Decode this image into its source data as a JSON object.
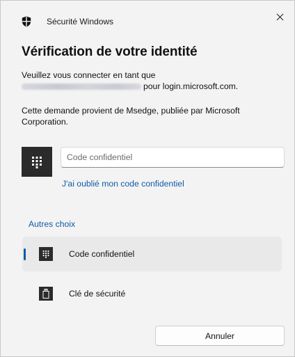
{
  "app": {
    "title": "Sécurité Windows",
    "icon": "windows-security-shield-icon"
  },
  "dialog": {
    "heading": "Vérification de votre identité",
    "connect_prefix": "Veuillez vous connecter en tant que",
    "connect_suffix": "pour login.microsoft.com.",
    "request_text": "Cette demande provient de Msedge, publiée par Microsoft Corporation."
  },
  "pin": {
    "placeholder": "Code confidentiel",
    "value": "",
    "forgot_link": "J'ai oublié mon code confidentiel",
    "tile_icon": "pin-keypad-icon"
  },
  "other_choices": {
    "label": "Autres choix",
    "options": [
      {
        "label": "Code confidentiel",
        "icon": "pin-keypad-icon",
        "selected": true
      },
      {
        "label": "Clé de sécurité",
        "icon": "usb-security-key-icon",
        "selected": false
      }
    ]
  },
  "buttons": {
    "cancel": "Annuler",
    "close_icon": "close-icon"
  },
  "colors": {
    "accent": "#0f5aa8",
    "window_bg": "#f3f3f3",
    "icon_tile": "#2b2b2b"
  }
}
